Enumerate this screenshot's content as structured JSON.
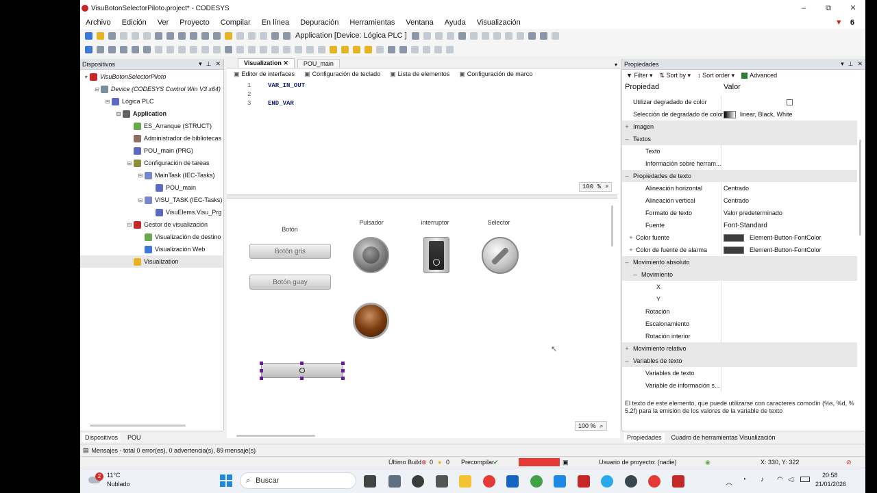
{
  "window": {
    "title": "VisuBotonSelectorPiloto.project* - CODESYS",
    "controls": [
      "–",
      "⧉",
      "✕"
    ],
    "error_count": "6"
  },
  "menu": [
    "Archivo",
    "Edición",
    "Ver",
    "Proyecto",
    "Compilar",
    "En línea",
    "Depuración",
    "Herramientas",
    "Ventana",
    "Ayuda",
    "Visualización"
  ],
  "toolbar": {
    "app_selector": "Application [Device: Lógica PLC ]"
  },
  "devices_panel": {
    "title": "Dispositivos",
    "tree": [
      {
        "label": "VisuBotonSelectorPiloto",
        "icon_color": "#c62828"
      },
      {
        "label": "Device (CODESYS Control Win V3 x64)",
        "icon_color": "#78909c"
      },
      {
        "label": "Lógica PLC",
        "icon_color": "#5c6bc0"
      },
      {
        "label": "Application",
        "icon_color": "#616161"
      },
      {
        "label": "ES_Arranque (STRUCT)",
        "icon_color": "#6aa84f"
      },
      {
        "label": "Administrador de bibliotecas",
        "icon_color": "#8d6e63"
      },
      {
        "label": "POU_main (PRG)",
        "icon_color": "#5c6bc0"
      },
      {
        "label": "Configuración de tareas",
        "icon_color": "#8d8d3c"
      },
      {
        "label": "MainTask (IEC-Tasks)",
        "icon_color": "#7986cb"
      },
      {
        "label": "POU_main",
        "icon_color": "#5c6bc0"
      },
      {
        "label": "VISU_TASK (IEC-Tasks)",
        "icon_color": "#7986cb"
      },
      {
        "label": "VisuElems.Visu_Prg",
        "icon_color": "#5c6bc0"
      },
      {
        "label": "Gestor de visualización",
        "icon_color": "#c62828"
      },
      {
        "label": "Visualización de destino",
        "icon_color": "#6aa84f"
      },
      {
        "label": "Visualización Web",
        "icon_color": "#3c78d8"
      },
      {
        "label": "Visualization",
        "icon_color": "#e6b422"
      }
    ],
    "bottom_tabs": [
      "Dispositivos",
      "POU"
    ]
  },
  "editor": {
    "tabs": [
      "Visualization",
      "POU_main"
    ],
    "subtabs": [
      "Editor de interfaces",
      "Configuración de teclado",
      "Lista de elementos",
      "Configuración de marco"
    ],
    "code_lines": [
      {
        "num": "1",
        "text": "VAR_IN_OUT"
      },
      {
        "num": "2",
        "text": ""
      },
      {
        "num": "3",
        "text": "END_VAR"
      }
    ],
    "zoom_top": "100 %",
    "zoom_bottom": "100 %"
  },
  "canvas": {
    "labels": {
      "boton": "Botón",
      "pulsador": "Pulsador",
      "interruptor": "interruptor",
      "selector": "Selector"
    },
    "button1": "Botón gris",
    "button2": "Botón guay"
  },
  "properties": {
    "title": "Propiedades",
    "filter": "Filter",
    "sort_by": "Sort by",
    "sort_order": "Sort order",
    "advanced": "Advanced",
    "col_property": "Propiedad",
    "col_value": "Valor",
    "rows": [
      {
        "name": "Utilizar degradado de color",
        "value": "",
        "type": "checkbox"
      },
      {
        "name": "Selección de degradado de color",
        "value": "linear, Black, White",
        "type": "gradient"
      },
      {
        "name": "Imagen",
        "value": "",
        "type": "cat",
        "exp": "+"
      },
      {
        "name": "Textos",
        "value": "",
        "type": "cat",
        "exp": "–"
      },
      {
        "name": "Texto",
        "value": "",
        "type": "sub"
      },
      {
        "name": "Información sobre herram...",
        "value": "",
        "type": "sub"
      },
      {
        "name": "Propiedades de texto",
        "value": "",
        "type": "cat",
        "exp": "–"
      },
      {
        "name": "Alineación horizontal",
        "value": "Centrado",
        "type": "sub"
      },
      {
        "name": "Alineación vertical",
        "value": "Centrado",
        "type": "sub"
      },
      {
        "name": "Formato de texto",
        "value": "Valor predeterminado",
        "type": "sub"
      },
      {
        "name": "Fuente",
        "value": "Font-Standard",
        "type": "sub",
        "big": true
      },
      {
        "name": "Color fuente",
        "value": "Element-Button-FontColor",
        "type": "color",
        "exp": "+"
      },
      {
        "name": "Color de fuente de alarma",
        "value": "Element-Button-FontColor",
        "type": "color",
        "exp": "+"
      },
      {
        "name": "Movimiento absoluto",
        "value": "",
        "type": "cat",
        "exp": "–"
      },
      {
        "name": "Movimiento",
        "value": "",
        "type": "subcat",
        "exp": "–"
      },
      {
        "name": "X",
        "value": "",
        "type": "subsub"
      },
      {
        "name": "Y",
        "value": "",
        "type": "subsub"
      },
      {
        "name": "Rotación",
        "value": "",
        "type": "sub"
      },
      {
        "name": "Escalonamiento",
        "value": "",
        "type": "sub"
      },
      {
        "name": "Rotación interior",
        "value": "",
        "type": "sub"
      },
      {
        "name": "Movimiento relativo",
        "value": "",
        "type": "cat",
        "exp": "+"
      },
      {
        "name": "Variables de texto",
        "value": "",
        "type": "cat",
        "exp": "–"
      },
      {
        "name": "Variables de texto",
        "value": "",
        "type": "sub"
      },
      {
        "name": "Variable de información s...",
        "value": "",
        "type": "sub"
      }
    ],
    "description": "El texto de este elemento, que puede utilizarse con caracteres comodín (%s, %d, % 5.2f) para la emisión de los valores de la variable de texto",
    "bottom_tabs": [
      "Propiedades",
      "Cuadro de herramientas Visualización"
    ]
  },
  "messages": "Mensajes - total 0 error(es), 0 advertencia(s), 89 mensaje(s)",
  "status": {
    "last_build": "Último Build",
    "errors": "0",
    "warnings": "0",
    "precompile": "Precompilar",
    "project_user": "Usuario de proyecto: (nadie)",
    "coords": "X: 330, Y: 322"
  },
  "taskbar": {
    "weather_temp": "11°C",
    "weather_desc": "Nublado",
    "weather_badge": "2",
    "search": "Buscar",
    "time": "20:58",
    "date": "21/01/2026"
  }
}
